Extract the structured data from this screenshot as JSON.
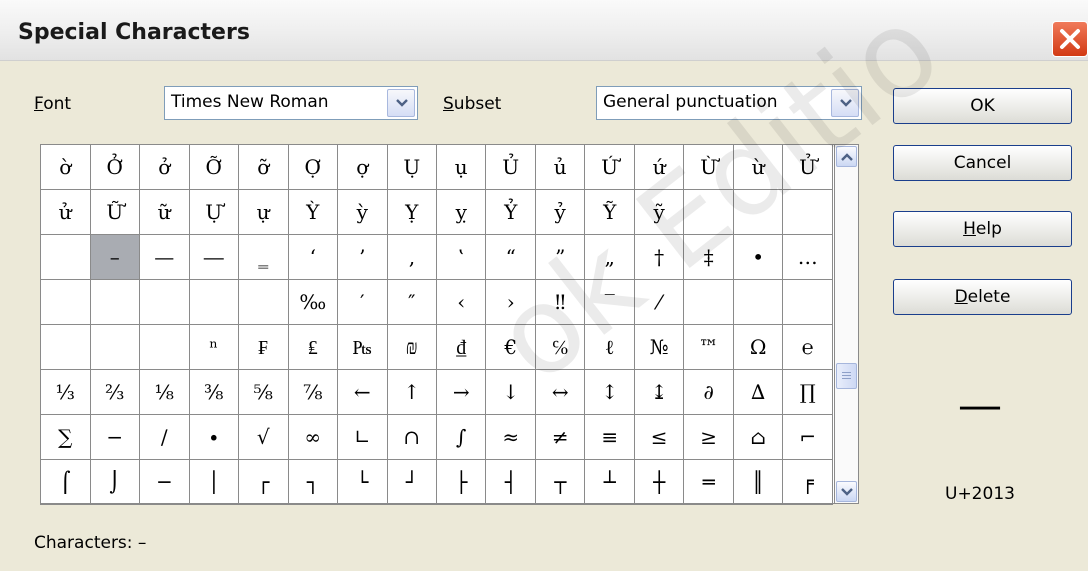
{
  "window": {
    "title": "Special Characters"
  },
  "font": {
    "label": "Font",
    "value": "Times New Roman"
  },
  "subset": {
    "label": "Subset",
    "value": "General punctuation"
  },
  "buttons": {
    "ok": "OK",
    "cancel": "Cancel",
    "help": "Help",
    "delete": "Delete"
  },
  "grid": {
    "rows": [
      [
        "ờ",
        "Ở",
        "ở",
        "Ỡ",
        "ỡ",
        "Ợ",
        "ợ",
        "Ụ",
        "ụ",
        "Ủ",
        "ủ",
        "Ứ",
        "ứ",
        "Ừ",
        "ừ",
        "Ử"
      ],
      [
        "ử",
        "Ữ",
        "ữ",
        "Ự",
        "ự",
        "Ỳ",
        "ỳ",
        "Ỵ",
        "ỵ",
        "Ỷ",
        "ỷ",
        "Ỹ",
        "ỹ",
        "",
        "",
        ""
      ],
      [
        "",
        "–",
        "—",
        "―",
        "‗",
        "‘",
        "’",
        "‚",
        "‛",
        "“",
        "”",
        "„",
        "†",
        "‡",
        "•",
        "…"
      ],
      [
        "",
        "",
        "",
        "",
        "",
        "‰",
        "′",
        "″",
        "‹",
        "›",
        "‼",
        "‾",
        "⁄",
        "",
        "",
        ""
      ],
      [
        "",
        "",
        "",
        "ⁿ",
        "₣",
        "₤",
        "₧",
        "₪",
        "₫",
        "€",
        "℅",
        "ℓ",
        "№",
        "™",
        "Ω",
        "℮"
      ],
      [
        "⅓",
        "⅔",
        "⅛",
        "⅜",
        "⅝",
        "⅞",
        "←",
        "↑",
        "→",
        "↓",
        "↔",
        "↕",
        "↨",
        "∂",
        "∆",
        "∏"
      ],
      [
        "∑",
        "−",
        "∕",
        "∙",
        "√",
        "∞",
        "∟",
        "∩",
        "∫",
        "≈",
        "≠",
        "≡",
        "≤",
        "≥",
        "⌂",
        "⌐"
      ],
      [
        "⌠",
        "⌡",
        "─",
        "│",
        "┌",
        "┐",
        "└",
        "┘",
        "├",
        "┤",
        "┬",
        "┴",
        "┼",
        "═",
        "║",
        "╒"
      ]
    ],
    "selected": "–"
  },
  "preview": {
    "char": "—",
    "code": "U+2013"
  },
  "characters": {
    "label": "Characters:",
    "value": "–"
  },
  "watermark": "ok Editio"
}
